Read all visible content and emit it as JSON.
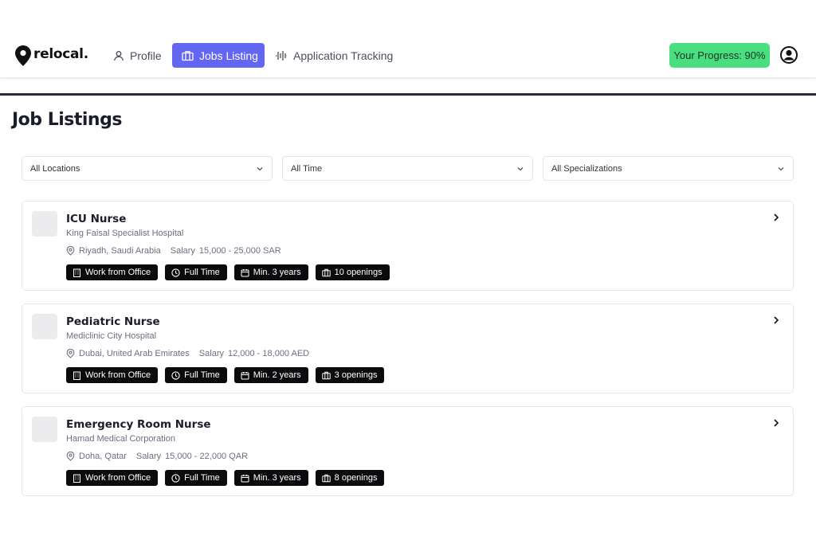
{
  "app": {
    "logo_text": "relocal.",
    "icons": {
      "logo": "map-pin-icon",
      "avatar": "user-circle-icon"
    }
  },
  "nav": {
    "items": [
      {
        "label": "Profile",
        "icon": "user-icon",
        "active": false
      },
      {
        "label": "Jobs Listing",
        "icon": "briefcase-icon",
        "active": true
      },
      {
        "label": "Application Tracking",
        "icon": "activity-icon",
        "active": false
      }
    ]
  },
  "progress": {
    "label": "Your Progress: 90%",
    "value_percent": 90
  },
  "page": {
    "title": "Job Listings"
  },
  "filters": [
    {
      "selected": "All Locations"
    },
    {
      "selected": "All Time"
    },
    {
      "selected": "All Specializations"
    }
  ],
  "jobs": [
    {
      "title": "ICU Nurse",
      "company": "King Faisal Specialist Hospital",
      "location": "Riyadh, Saudi Arabia",
      "salary_label": "Salary",
      "salary": "15,000 - 25,000 SAR",
      "tags": [
        "Work from Office",
        "Full Time",
        "Min. 3 years",
        "10 openings"
      ]
    },
    {
      "title": "Pediatric Nurse",
      "company": "Mediclinic City Hospital",
      "location": "Dubai, United Arab Emirates",
      "salary_label": "Salary",
      "salary": "12,000 - 18,000 AED",
      "tags": [
        "Work from Office",
        "Full Time",
        "Min. 2 years",
        "3 openings"
      ]
    },
    {
      "title": "Emergency Room Nurse",
      "company": "Hamad Medical Corporation",
      "location": "Doha, Qatar",
      "salary_label": "Salary",
      "salary": "15,000 - 22,000 QAR",
      "tags": [
        "Work from Office",
        "Full Time",
        "Min. 3 years",
        "8 openings"
      ]
    }
  ],
  "colors": {
    "accent": "#6366f1",
    "progress_bg": "#4ade80",
    "tag_bg": "#0b0b0d",
    "divider": "#252a3a"
  }
}
